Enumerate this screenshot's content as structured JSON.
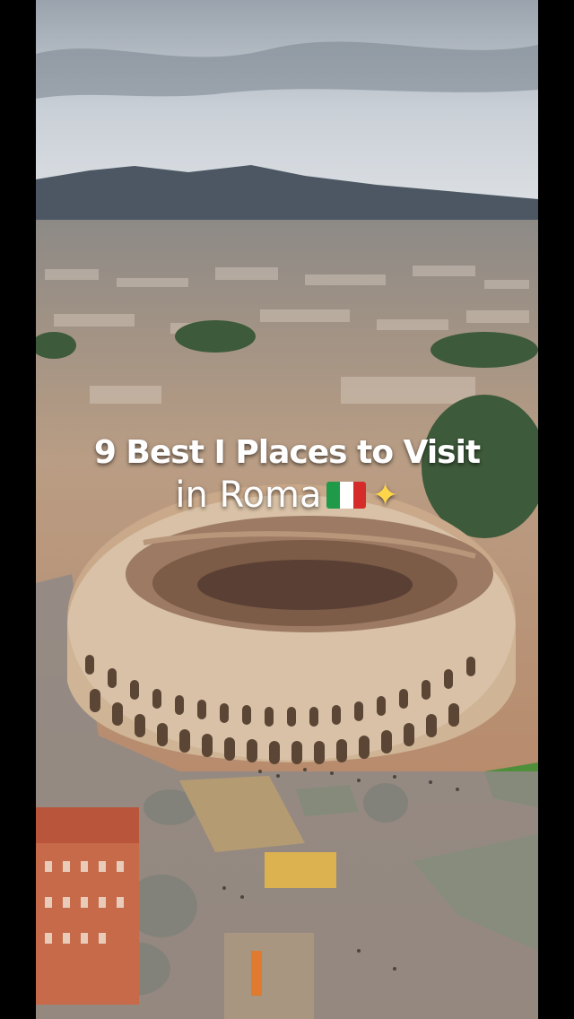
{
  "caption": {
    "line1": "9 Best I Places to Visit",
    "line2": "in Roma",
    "flag_icon": "italy-flag-icon",
    "sparkle_icon": "sparkles-icon",
    "flag_colors": [
      "#1f9a49",
      "#ffffff",
      "#d52b2b"
    ],
    "sparkle_color": "#ffd54a"
  }
}
